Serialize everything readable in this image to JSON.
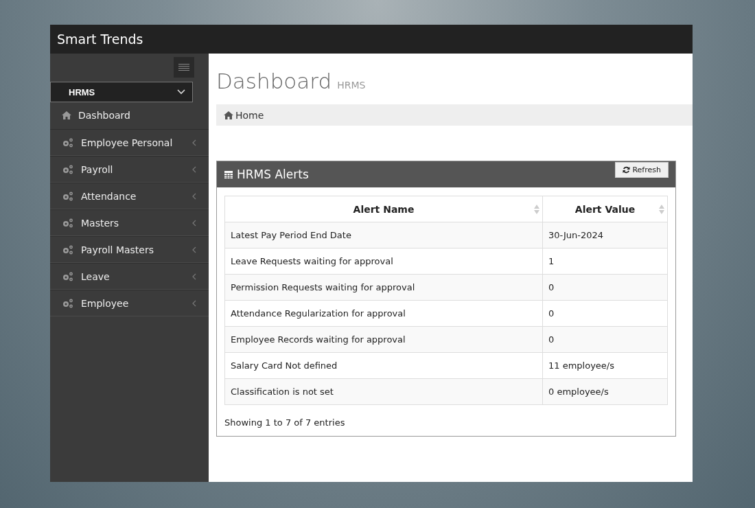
{
  "app": {
    "title": "Smart Trends"
  },
  "sidebar": {
    "module": "HRMS",
    "items": [
      {
        "label": "Dashboard",
        "kind": "home",
        "has_submenu": false
      },
      {
        "label": "Employee Personal",
        "kind": "gears",
        "has_submenu": true
      },
      {
        "label": "Payroll",
        "kind": "gears",
        "has_submenu": true
      },
      {
        "label": "Attendance",
        "kind": "gears",
        "has_submenu": true
      },
      {
        "label": "Masters",
        "kind": "gears",
        "has_submenu": true
      },
      {
        "label": "Payroll Masters",
        "kind": "gears",
        "has_submenu": true
      },
      {
        "label": "Leave",
        "kind": "gears",
        "has_submenu": true
      },
      {
        "label": "Employee",
        "kind": "gears",
        "has_submenu": true
      }
    ]
  },
  "page": {
    "title": "Dashboard",
    "subtitle": "HRMS",
    "breadcrumb": "Home"
  },
  "panel": {
    "title": "HRMS Alerts",
    "button": "Refresh",
    "table": {
      "columns": [
        "Alert Name",
        "Alert Value"
      ],
      "rows": [
        [
          "Latest Pay Period End Date",
          "30-Jun-2024"
        ],
        [
          "Leave Requests waiting for approval",
          "1"
        ],
        [
          "Permission Requests waiting for approval",
          "0"
        ],
        [
          "Attendance Regularization for approval",
          "0"
        ],
        [
          "Employee Records waiting for approval",
          "0"
        ],
        [
          "Salary Card Not defined",
          "11 employee/s"
        ],
        [
          "Classification is not set",
          "0 employee/s"
        ]
      ]
    },
    "footer": "Showing 1 to 7 of 7 entries"
  }
}
